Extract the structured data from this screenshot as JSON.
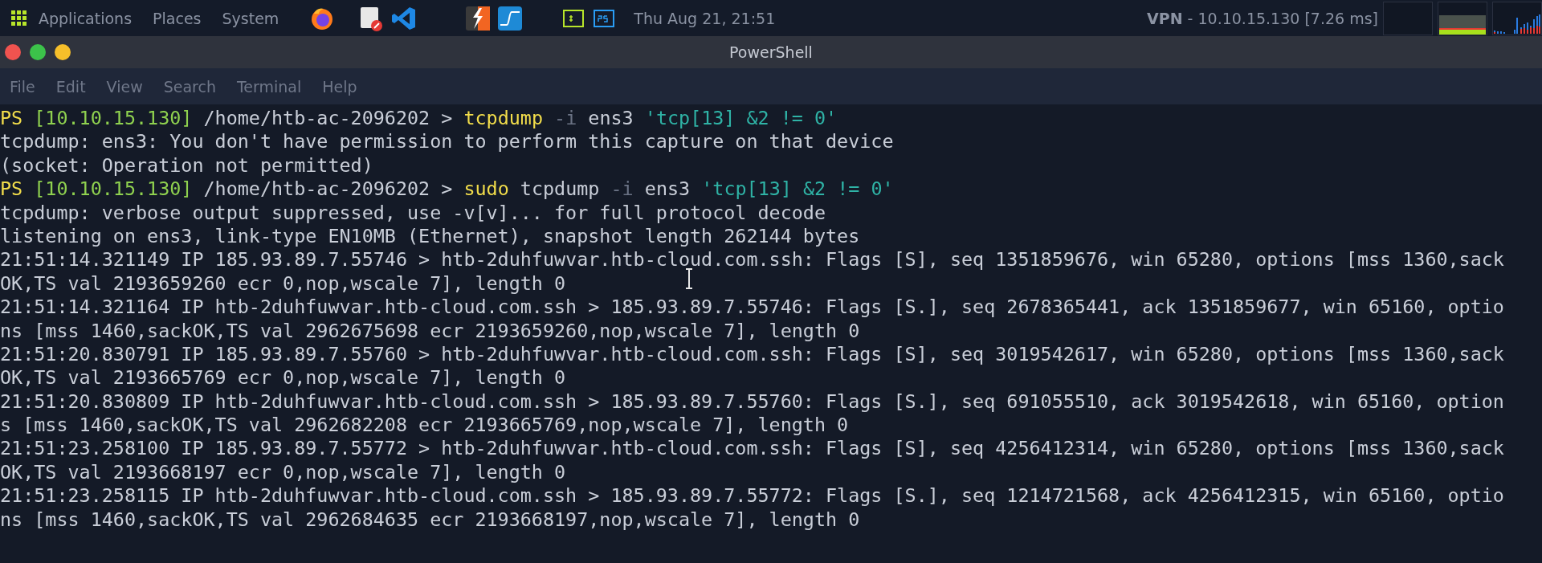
{
  "top_bar": {
    "menus": [
      "Applications",
      "Places",
      "System"
    ],
    "clock": "Thu Aug 21, 21:51",
    "vpn": {
      "label": "VPN",
      "text": "- 10.10.15.130 [7.26 ms]"
    }
  },
  "window": {
    "title": "PowerShell"
  },
  "menu_bar": [
    "File",
    "Edit",
    "View",
    "Search",
    "Terminal",
    "Help"
  ],
  "terminal": {
    "lines": [
      {
        "kind": "prompt",
        "ps": "PS",
        "host": "[10.10.15.130]",
        "path": "/home/htb-ac-2096202 >",
        "command": [
          {
            "kind": "program",
            "text": "tcpdump"
          },
          {
            "kind": "flag",
            "text": "-i"
          },
          {
            "kind": "plain",
            "text": "ens3"
          },
          {
            "kind": "string",
            "text": "'tcp[13] &2 != 0'"
          }
        ]
      },
      {
        "kind": "output",
        "text": "tcpdump: ens3: You don't have permission to perform this capture on that device"
      },
      {
        "kind": "output",
        "text": "(socket: Operation not permitted)"
      },
      {
        "kind": "prompt",
        "ps": "PS",
        "host": "[10.10.15.130]",
        "path": "/home/htb-ac-2096202 >",
        "command": [
          {
            "kind": "program",
            "text": "sudo"
          },
          {
            "kind": "plain",
            "text": "tcpdump"
          },
          {
            "kind": "flag",
            "text": "-i"
          },
          {
            "kind": "plain",
            "text": "ens3"
          },
          {
            "kind": "string",
            "text": "'tcp[13] &2 != 0'"
          }
        ]
      },
      {
        "kind": "output",
        "text": "tcpdump: verbose output suppressed, use -v[v]... for full protocol decode"
      },
      {
        "kind": "output",
        "text": "listening on ens3, link-type EN10MB (Ethernet), snapshot length 262144 bytes"
      },
      {
        "kind": "output",
        "text": "21:51:14.321149 IP 185.93.89.7.55746 > htb-2duhfuwvar.htb-cloud.com.ssh: Flags [S], seq 1351859676, win 65280, options [mss 1360,sack"
      },
      {
        "kind": "output",
        "text": "OK,TS val 2193659260 ecr 0,nop,wscale 7], length 0"
      },
      {
        "kind": "output",
        "text": "21:51:14.321164 IP htb-2duhfuwvar.htb-cloud.com.ssh > 185.93.89.7.55746: Flags [S.], seq 2678365441, ack 1351859677, win 65160, optio"
      },
      {
        "kind": "output",
        "text": "ns [mss 1460,sackOK,TS val 2962675698 ecr 2193659260,nop,wscale 7], length 0"
      },
      {
        "kind": "output",
        "text": "21:51:20.830791 IP 185.93.89.7.55760 > htb-2duhfuwvar.htb-cloud.com.ssh: Flags [S], seq 3019542617, win 65280, options [mss 1360,sack"
      },
      {
        "kind": "output",
        "text": "OK,TS val 2193665769 ecr 0,nop,wscale 7], length 0"
      },
      {
        "kind": "output",
        "text": "21:51:20.830809 IP htb-2duhfuwvar.htb-cloud.com.ssh > 185.93.89.7.55760: Flags [S.], seq 691055510, ack 3019542618, win 65160, option"
      },
      {
        "kind": "output",
        "text": "s [mss 1460,sackOK,TS val 2962682208 ecr 2193665769,nop,wscale 7], length 0"
      },
      {
        "kind": "output",
        "text": "21:51:23.258100 IP 185.93.89.7.55772 > htb-2duhfuwvar.htb-cloud.com.ssh: Flags [S], seq 4256412314, win 65280, options [mss 1360,sack"
      },
      {
        "kind": "output",
        "text": "OK,TS val 2193668197 ecr 0,nop,wscale 7], length 0"
      },
      {
        "kind": "output",
        "text": "21:51:23.258115 IP htb-2duhfuwvar.htb-cloud.com.ssh > 185.93.89.7.55772: Flags [S.], seq 1214721568, ack 4256412315, win 65160, optio"
      },
      {
        "kind": "output",
        "text": "ns [mss 1460,sackOK,TS val 2962684635 ecr 2193668197,nop,wscale 7], length 0"
      }
    ]
  }
}
